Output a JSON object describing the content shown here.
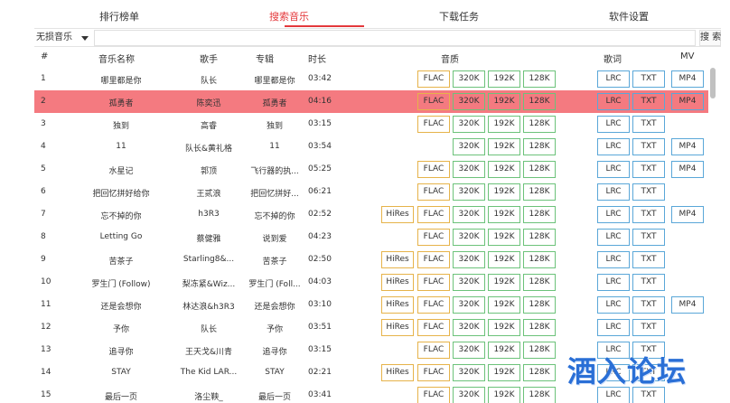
{
  "tabs": [
    "排行榜单",
    "搜索音乐",
    "下载任务",
    "软件设置"
  ],
  "search": {
    "source": "无损音乐",
    "button": "搜 索",
    "value": ""
  },
  "columns": {
    "num": "#",
    "title": "音乐名称",
    "artist": "歌手",
    "album": "专辑",
    "duration": "时长",
    "quality": "音质",
    "lyrics": "歌词",
    "mv": "MV"
  },
  "buttons": {
    "hires": "HiRes",
    "flac": "FLAC",
    "q320": "320K",
    "q192": "192K",
    "q128": "128K",
    "lrc": "LRC",
    "txt": "TXT",
    "mp4": "MP4"
  },
  "rows": [
    {
      "num": "1",
      "title": "哪里都是你",
      "artist": "队长",
      "album": "哪里都是你",
      "duration": "03:42",
      "hires": false,
      "flac": true,
      "mp4": true
    },
    {
      "num": "2",
      "title": "孤勇者",
      "artist": "陈奕迅",
      "album": "孤勇者",
      "duration": "04:16",
      "hires": false,
      "flac": true,
      "mp4": true
    },
    {
      "num": "3",
      "title": "独到",
      "artist": "高睿",
      "album": "独到",
      "duration": "03:15",
      "hires": false,
      "flac": true,
      "mp4": false
    },
    {
      "num": "4",
      "title": "11",
      "artist": "队长&黄礼格",
      "album": "11",
      "duration": "03:54",
      "hires": false,
      "flac": false,
      "mp4": true
    },
    {
      "num": "5",
      "title": "水星记",
      "artist": "郭顶",
      "album": "飞行器的执...",
      "duration": "05:25",
      "hires": false,
      "flac": true,
      "mp4": true
    },
    {
      "num": "6",
      "title": "把回忆拼好给你",
      "artist": "王贰浪",
      "album": "把回忆拼好...",
      "duration": "06:21",
      "hires": false,
      "flac": true,
      "mp4": false
    },
    {
      "num": "7",
      "title": "忘不掉的你",
      "artist": "h3R3",
      "album": "忘不掉的你",
      "duration": "02:52",
      "hires": true,
      "flac": true,
      "mp4": true
    },
    {
      "num": "8",
      "title": "Letting Go",
      "artist": "蔡健雅",
      "album": "说到爱",
      "duration": "04:23",
      "hires": false,
      "flac": true,
      "mp4": false
    },
    {
      "num": "9",
      "title": "苦茶子",
      "artist": "Starling8&...",
      "album": "苦茶子",
      "duration": "02:50",
      "hires": true,
      "flac": true,
      "mp4": false
    },
    {
      "num": "10",
      "title": "罗生门 (Follow)",
      "artist": "梨冻紧&Wiz...",
      "album": "罗生门 (Foll...",
      "duration": "04:03",
      "hires": true,
      "flac": true,
      "mp4": false
    },
    {
      "num": "11",
      "title": "还是会想你",
      "artist": "林达浪&h3R3",
      "album": "还是会想你",
      "duration": "03:10",
      "hires": true,
      "flac": true,
      "mp4": true
    },
    {
      "num": "12",
      "title": "予你",
      "artist": "队长",
      "album": "予你",
      "duration": "03:51",
      "hires": true,
      "flac": true,
      "mp4": false
    },
    {
      "num": "13",
      "title": "追寻你",
      "artist": "王天戈&川青",
      "album": "追寻你",
      "duration": "03:15",
      "hires": false,
      "flac": true,
      "mp4": false
    },
    {
      "num": "14",
      "title": "STAY",
      "artist": "The Kid LAR...",
      "album": "STAY",
      "duration": "02:21",
      "hires": true,
      "flac": true,
      "mp4": false
    },
    {
      "num": "15",
      "title": "最后一页",
      "artist": "洛尘鞅_",
      "album": "最后一页",
      "duration": "03:41",
      "hires": false,
      "flac": true,
      "mp4": false
    }
  ],
  "selected_row": "2",
  "watermark": "酒入论坛",
  "colors": {
    "accent": "#e4393c",
    "selected_row": "#f47a80",
    "flac_border": "#e6b34a",
    "bitrate_border": "#6cc27a",
    "lyrics_border": "#5aa7d8"
  }
}
